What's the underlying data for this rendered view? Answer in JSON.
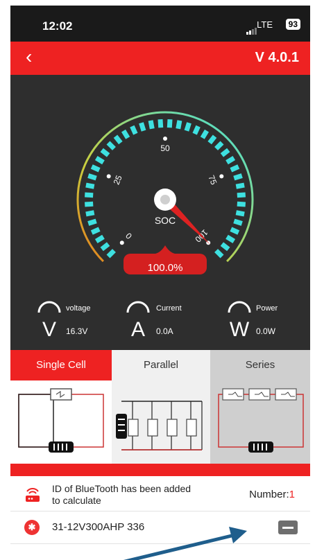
{
  "status_bar": {
    "time": "12:02",
    "network": "LTE",
    "battery": "93"
  },
  "header": {
    "back_icon": "chevron-left-icon",
    "version": "V 4.0.1"
  },
  "gauge": {
    "center_label": "SOC",
    "value_label": "100.0%",
    "soc_percent": 100,
    "ticks": [
      "0",
      "25",
      "50",
      "75",
      "100"
    ],
    "colors": {
      "segment": "#3ee0e0",
      "needle": "#dd2222"
    }
  },
  "meters": [
    {
      "symbol": "V",
      "label": "voltage",
      "value": "16.3V"
    },
    {
      "symbol": "A",
      "label": "Current",
      "value": "0.0A"
    },
    {
      "symbol": "W",
      "label": "Power",
      "value": "0.0W"
    }
  ],
  "tabs": [
    "Single Cell",
    "Parallel",
    "Series"
  ],
  "info_row": {
    "text": "ID of BlueTooth has been added to calculate",
    "number_label": "Number:",
    "number_value": "1"
  },
  "devices": [
    {
      "name": "31-12V300AHP 336"
    }
  ],
  "colors": {
    "brand": "#ee2222",
    "background": "#2e2e2e",
    "annotation_arrow": "#1f5e8c"
  }
}
